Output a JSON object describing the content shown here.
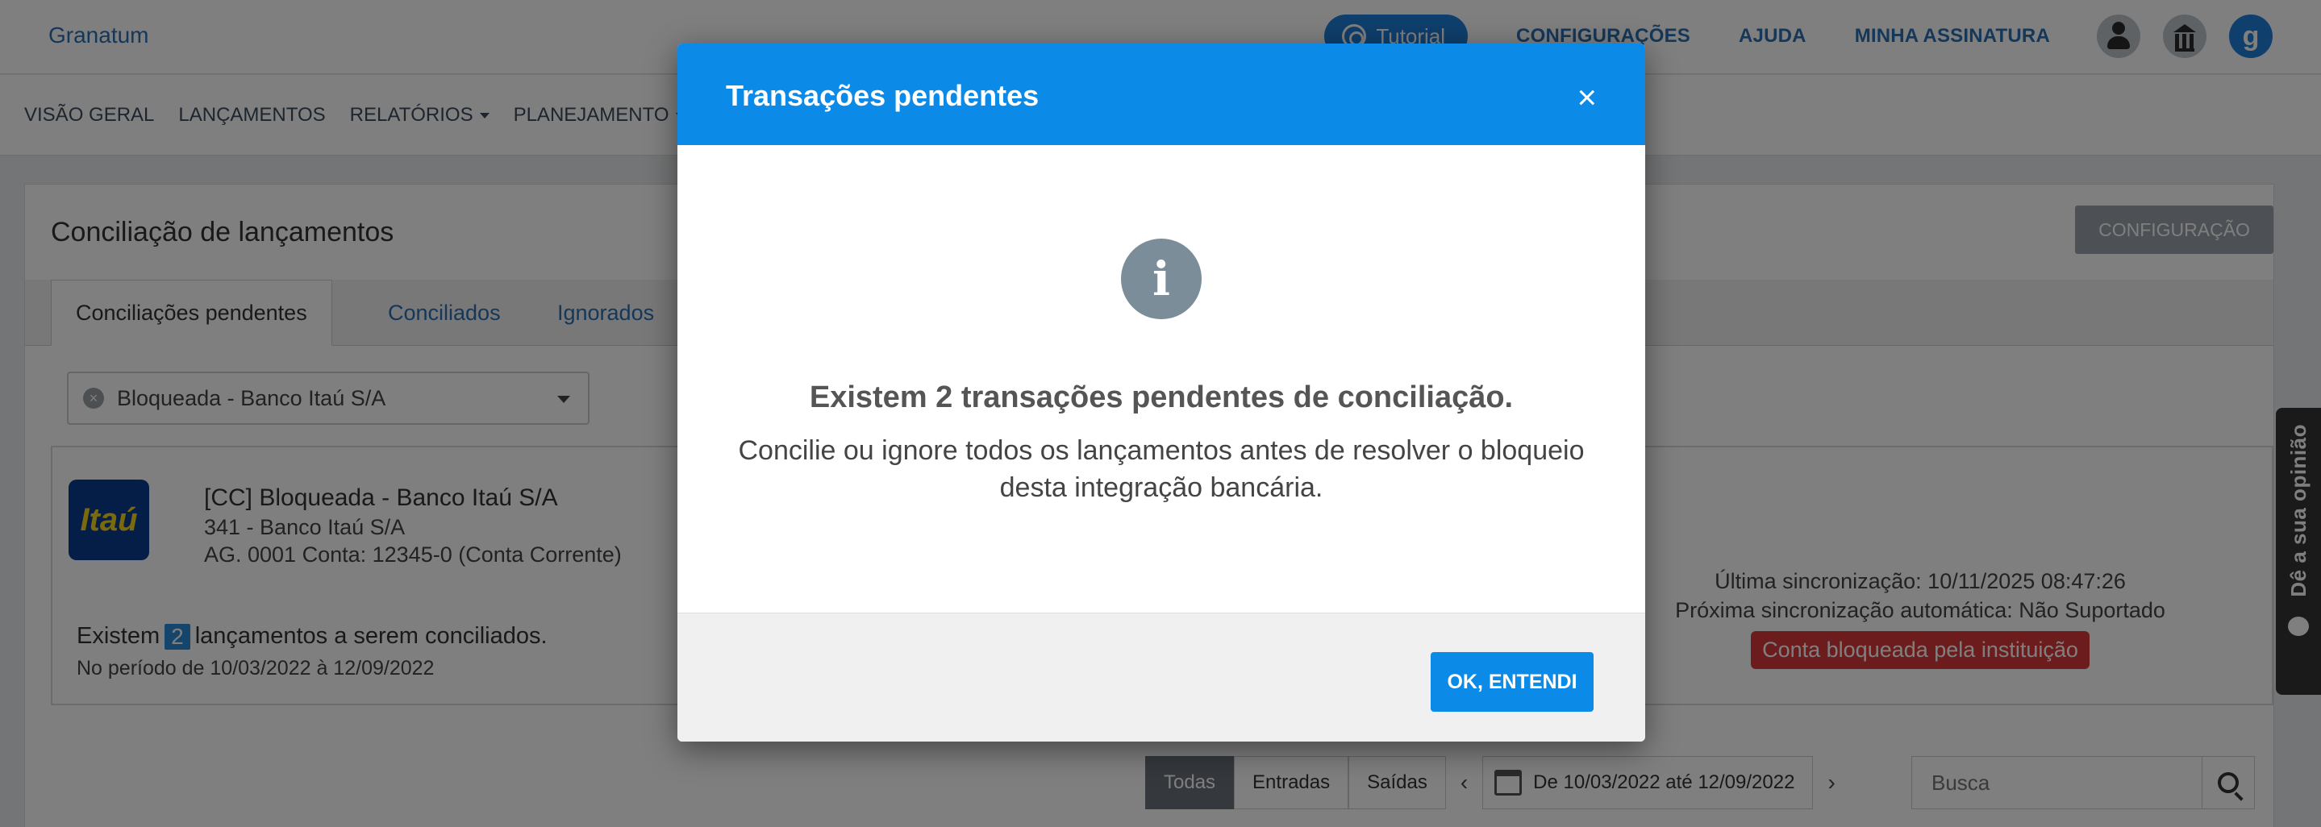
{
  "header": {
    "brand": "Granatum",
    "tutorial_label": "Tutorial",
    "links": [
      "CONFIGURAÇÕES",
      "AJUDA",
      "MINHA ASSINATURA"
    ],
    "avatar_letter": "g"
  },
  "nav": {
    "items": [
      "VISÃO GERAL",
      "LANÇAMENTOS",
      "RELATÓRIOS",
      "PLANEJAMENTO",
      "C"
    ]
  },
  "page": {
    "title": "Conciliação de lançamentos",
    "config_button": "CONFIGURAÇÃO",
    "tabs": [
      "Conciliações pendentes",
      "Conciliados",
      "Ignorados"
    ],
    "account_select": "Bloqueada - Banco Itaú S/A",
    "account": {
      "logo_text": "Itaú",
      "name": "[CC] Bloqueada - Banco Itaú S/A",
      "bank": "341 - Banco Itaú S/A",
      "agency_line": "AG. 0001   Conta: 12345-0   (Conta Corrente)",
      "pending_prefix": "Existem",
      "pending_count": "2",
      "pending_suffix": "lançamentos a serem conciliados.",
      "period": "No período de 10/03/2022 à 12/09/2022",
      "last_sync": "Última sincronização: 10/11/2025 08:47:26",
      "next_sync": "Próxima sincronização automática: Não Suportado",
      "blocked_badge": "Conta bloqueada pela instituição"
    },
    "filters": {
      "segments": [
        "Todas",
        "Entradas",
        "Saídas"
      ],
      "date_range": "De 10/03/2022 até 12/09/2022",
      "search_placeholder": "Busca"
    },
    "feedback_label": "Dê a sua opinião"
  },
  "modal": {
    "title": "Transações pendentes",
    "close_glyph": "×",
    "heading": "Existem 2 transações pendentes de conciliação.",
    "description": "Concilie ou ignore todos os lançamentos antes de resolver o bloqueio desta integração bancária.",
    "ok_button": "OK, ENTENDI"
  },
  "colors": {
    "accent": "#0b8ae8",
    "danger": "#d93838",
    "itau_blue": "#0a3d8f",
    "itau_yellow": "#f7d21a"
  }
}
